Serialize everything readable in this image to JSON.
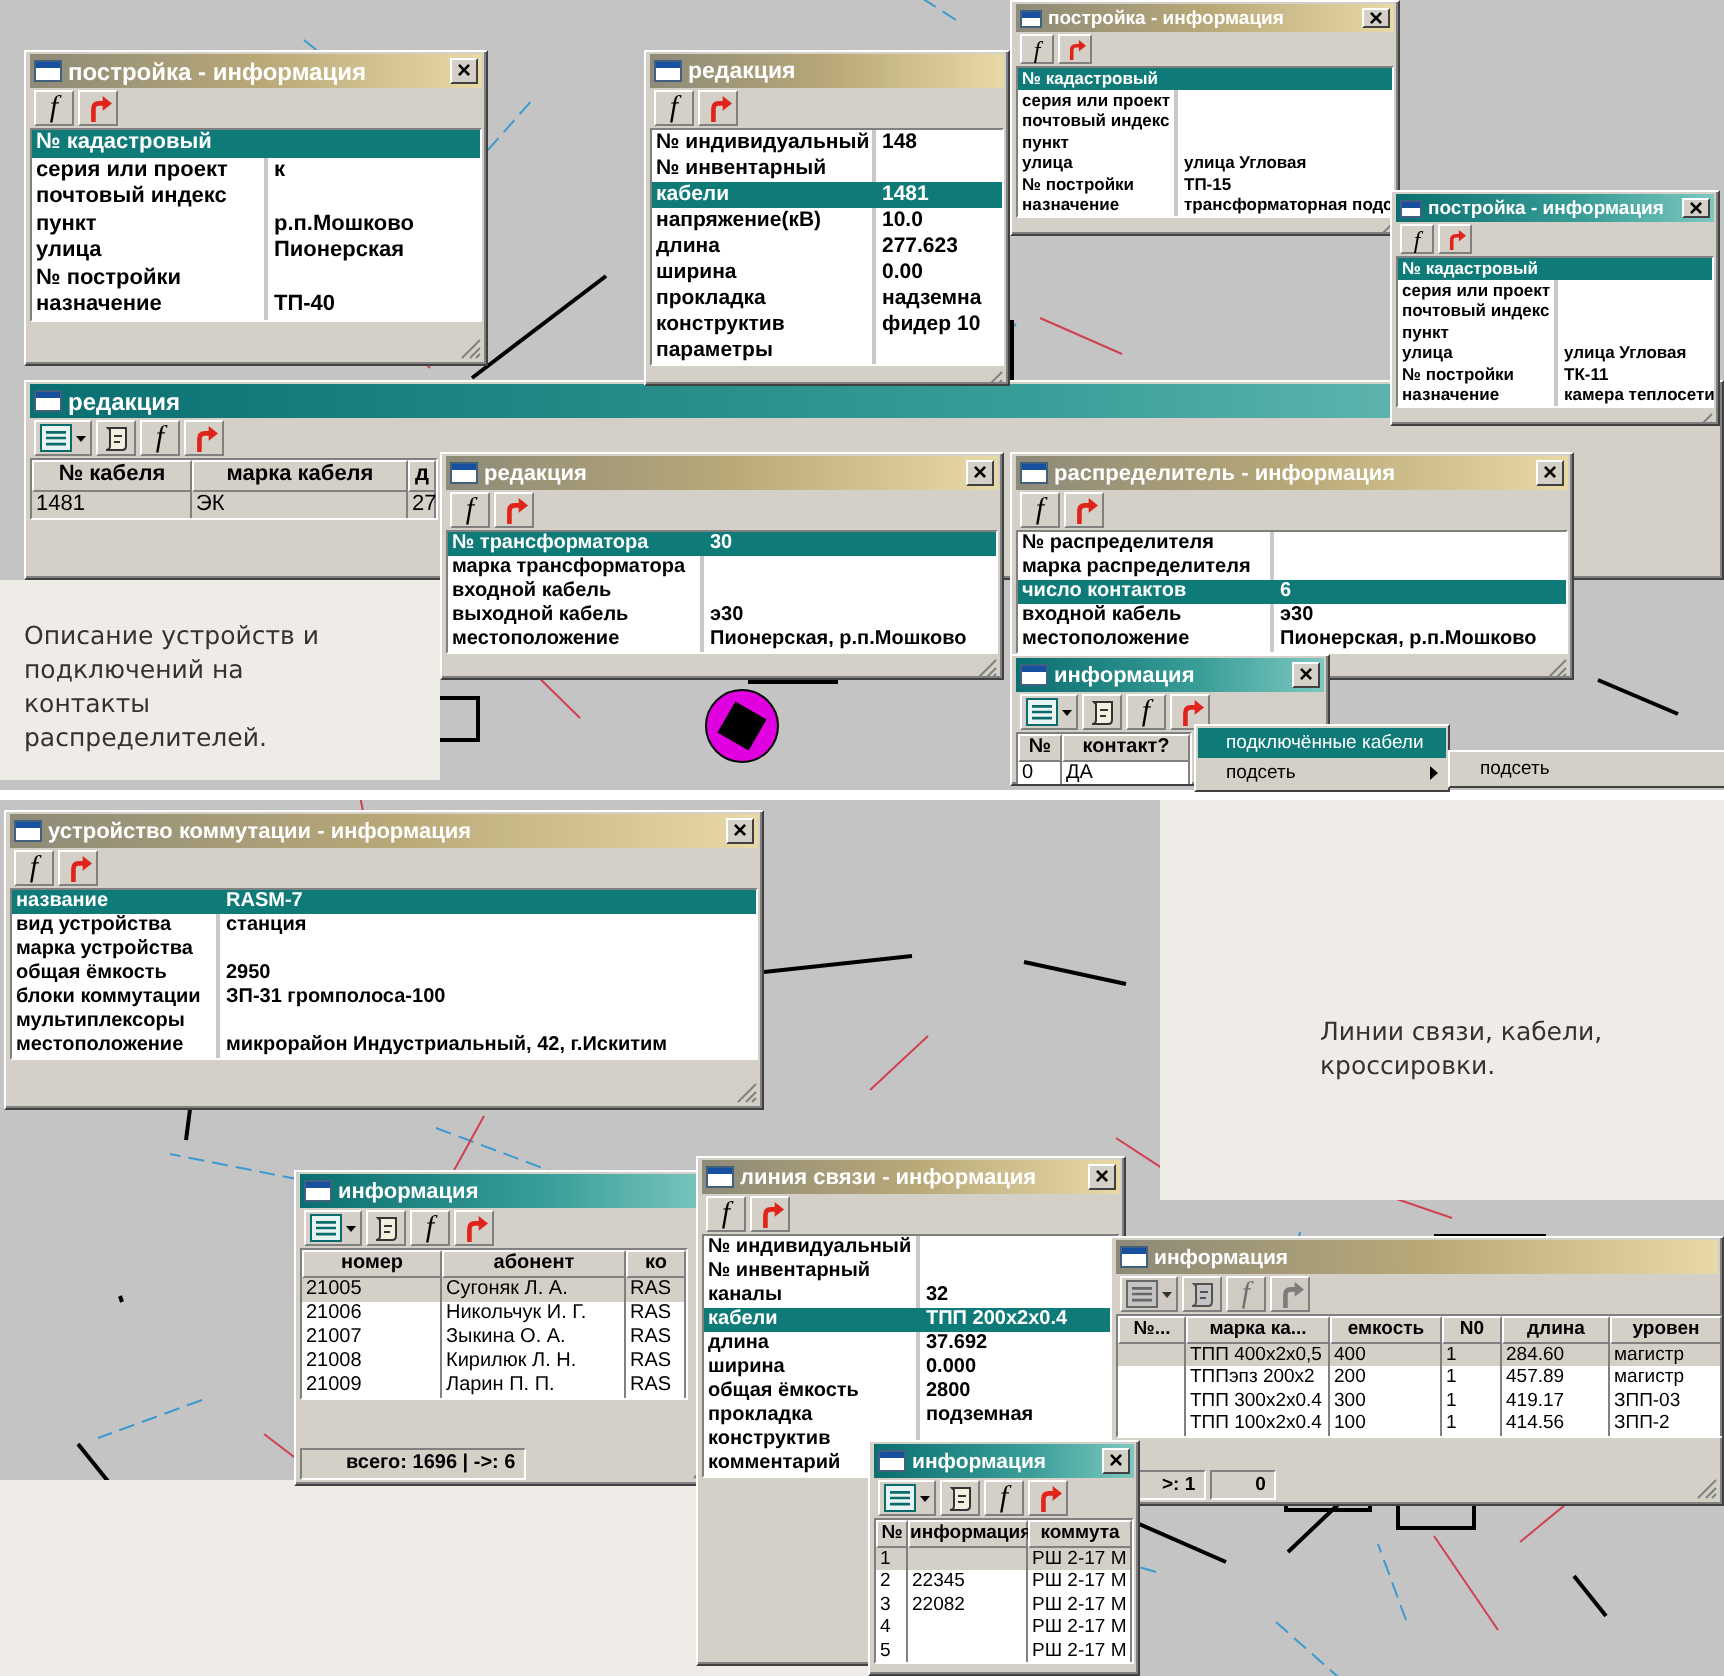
{
  "captions": [
    "Описание устройств и подключений на контакты распределителей.",
    "Линии связи, кабели, кроссировки."
  ],
  "windows": [
    {
      "kind": "props",
      "title": "постройка - информация",
      "active": false,
      "close": "×",
      "toolbar": {
        "disabled": false,
        "tools": [
          {
            "kind": "function",
            "label": "f"
          },
          {
            "kind": "back"
          }
        ]
      },
      "rows": [
        {
          "label": "№ кадастровый",
          "selected": true
        },
        {
          "label": "серия или проект",
          "value": "к",
          "selected": false
        },
        {
          "label": "почтовый индекс",
          "selected": false
        },
        {
          "label": "пункт",
          "value": "р.п.Мошково",
          "selected": false
        },
        {
          "label": "улица",
          "value": "Пионерская",
          "selected": false
        },
        {
          "label": "№ постройки",
          "selected": false
        },
        {
          "label": "назначение",
          "value": "ТП-40",
          "selected": false
        }
      ]
    },
    {
      "kind": "props",
      "title": "редакция",
      "active": false,
      "toolbar": {
        "disabled": false,
        "tools": [
          {
            "kind": "function",
            "label": "f"
          },
          {
            "kind": "back"
          }
        ]
      },
      "rows": [
        {
          "label": "№ индивидуальный",
          "value": "148",
          "selected": false
        },
        {
          "label": "№ инвентарный",
          "selected": false
        },
        {
          "label": "кабели",
          "value": "1481",
          "selected": true
        },
        {
          "label": "напряжение(кВ)",
          "value": "10.0",
          "selected": false
        },
        {
          "label": "длина",
          "value": "277.623",
          "selected": false
        },
        {
          "label": "ширина",
          "value": "0.00",
          "selected": false
        },
        {
          "label": "прокладка",
          "value": "надземна",
          "selected": false
        },
        {
          "label": "конструктив",
          "value": "фидер 10",
          "selected": false
        },
        {
          "label": "параметры",
          "selected": false
        }
      ]
    },
    {
      "kind": "props",
      "title": "постройка - информация",
      "active": false,
      "close": "×",
      "toolbar": {
        "disabled": false,
        "tools": [
          {
            "kind": "function",
            "label": "f"
          },
          {
            "kind": "back"
          }
        ]
      },
      "rows": [
        {
          "label": "№ кадастровый",
          "selected": true
        },
        {
          "label": "серия или проект",
          "selected": false
        },
        {
          "label": "почтовый индекс",
          "selected": false
        },
        {
          "label": "пункт",
          "selected": false
        },
        {
          "label": "улица",
          "value": "улица Угловая",
          "selected": false
        },
        {
          "label": "№ постройки",
          "value": "ТП-15",
          "selected": false
        },
        {
          "label": "назначение",
          "value": "трансформаторная подс",
          "selected": false
        }
      ]
    },
    {
      "kind": "props",
      "title": "постройка - информация",
      "active": true,
      "close": "×",
      "toolbar": {
        "disabled": false,
        "tools": [
          {
            "kind": "function",
            "label": "f"
          },
          {
            "kind": "back"
          }
        ]
      },
      "rows": [
        {
          "label": "№ кадастровый",
          "selected": true
        },
        {
          "label": "серия или проект",
          "selected": false
        },
        {
          "label": "почтовый индекс",
          "selected": false
        },
        {
          "label": "пункт",
          "selected": false
        },
        {
          "label": "улица",
          "value": "улица Угловая",
          "selected": false
        },
        {
          "label": "№ постройки",
          "value": "ТК-11",
          "selected": false
        },
        {
          "label": "назначение",
          "value": "камера теплосети",
          "selected": false
        }
      ]
    },
    {
      "kind": "table",
      "title": "редакция",
      "active": true,
      "toolbar": {
        "disabled": false,
        "tools": [
          {
            "kind": "list"
          },
          {
            "kind": "scroll"
          },
          {
            "kind": "function",
            "label": "f"
          },
          {
            "kind": "back"
          }
        ]
      },
      "columns": [
        "№ кабеля",
        "марка кабеля",
        "д"
      ],
      "rows": [
        {
          "cells": [
            "1481",
            "ЭК",
            "27"
          ],
          "selected": true
        }
      ]
    },
    {
      "kind": "props",
      "title": "редакция",
      "active": false,
      "close": "×",
      "toolbar": {
        "disabled": false,
        "tools": [
          {
            "kind": "function",
            "label": "f"
          },
          {
            "kind": "back"
          }
        ]
      },
      "rows": [
        {
          "label": "№ трансформатора",
          "value": "30",
          "selected": true
        },
        {
          "label": "марка трансформатора",
          "selected": false
        },
        {
          "label": "входной кабель",
          "selected": false
        },
        {
          "label": "выходной кабель",
          "value": "э30",
          "selected": false
        },
        {
          "label": "местоположение",
          "value": "Пионерская, р.п.Мошково",
          "selected": false
        }
      ]
    },
    {
      "kind": "props",
      "title": "распределитель - информация",
      "active": false,
      "close": "×",
      "toolbar": {
        "disabled": false,
        "tools": [
          {
            "kind": "function",
            "label": "f"
          },
          {
            "kind": "back"
          }
        ]
      },
      "rows": [
        {
          "label": "№ распределителя",
          "selected": false
        },
        {
          "label": "марка распределителя",
          "selected": false
        },
        {
          "label": "число контактов",
          "value": "6",
          "selected": true
        },
        {
          "label": "входной кабель",
          "value": "э30",
          "selected": false
        },
        {
          "label": "местоположение",
          "value": "Пионерская, р.п.Мошково",
          "selected": false
        }
      ]
    },
    {
      "kind": "table",
      "title": "информация",
      "active": true,
      "close": "×",
      "toolbar": {
        "disabled": false,
        "tools": [
          {
            "kind": "list"
          },
          {
            "kind": "scroll"
          },
          {
            "kind": "function",
            "label": "f"
          },
          {
            "kind": "back"
          }
        ]
      },
      "columns": [
        "№",
        "контакт?"
      ],
      "rows": [
        {
          "cells": [
            "0",
            "ДА"
          ],
          "selected": false
        }
      ]
    },
    {
      "kind": "props",
      "title": "устройство коммутации - информация",
      "active": false,
      "close": "×",
      "toolbar": {
        "disabled": false,
        "tools": [
          {
            "kind": "function",
            "label": "f"
          },
          {
            "kind": "back"
          }
        ]
      },
      "rows": [
        {
          "label": "название",
          "value": "RASM-7",
          "selected": true
        },
        {
          "label": "вид устройства",
          "value": "станция",
          "selected": false
        },
        {
          "label": "марка устройства",
          "selected": false
        },
        {
          "label": "общая ёмкость",
          "value": "2950",
          "selected": false
        },
        {
          "label": "блоки коммутации",
          "value": "ЗП-31 громполоса-100",
          "selected": false
        },
        {
          "label": "мультиплексоры",
          "selected": false
        },
        {
          "label": "местоположение",
          "value": "микрорайон Индустриальный, 42, г.Искитим",
          "selected": false
        }
      ]
    },
    {
      "kind": "table",
      "title": "информация",
      "active": true,
      "toolbar": {
        "disabled": false,
        "tools": [
          {
            "kind": "list"
          },
          {
            "kind": "scroll"
          },
          {
            "kind": "function",
            "label": "f"
          },
          {
            "kind": "back"
          }
        ]
      },
      "columns": [
        "номер",
        "абонент",
        "ко"
      ],
      "rows": [
        {
          "cells": [
            "21005",
            "Сугоняк Л. А.",
            "RAS"
          ],
          "selected": true
        },
        {
          "cells": [
            "21006",
            "Никольчук И. Г.",
            "RAS"
          ],
          "selected": false
        },
        {
          "cells": [
            "21007",
            "Зыкина О. А.",
            "RAS"
          ],
          "selected": false
        },
        {
          "cells": [
            "21008",
            "Кирилюк Л. Н.",
            "RAS"
          ],
          "selected": false
        },
        {
          "cells": [
            "21009",
            "Ларин П. П.",
            "RAS"
          ],
          "selected": false
        }
      ],
      "status": [
        "всего: 1696 | ->: 6"
      ]
    },
    {
      "kind": "props",
      "title": "линия связи - информация",
      "active": false,
      "close": "×",
      "toolbar": {
        "disabled": false,
        "tools": [
          {
            "kind": "function",
            "label": "f"
          },
          {
            "kind": "back"
          }
        ]
      },
      "rows": [
        {
          "label": "№ индивидуальный",
          "selected": false
        },
        {
          "label": "№ инвентарный",
          "selected": false
        },
        {
          "label": "каналы",
          "value": "32",
          "selected": false
        },
        {
          "label": "кабели",
          "value": "ТПП 200x2x0.4",
          "selected": true
        },
        {
          "label": "длина",
          "value": "37.692",
          "selected": false
        },
        {
          "label": "ширина",
          "value": "0.000",
          "selected": false
        },
        {
          "label": "общая ёмкость",
          "value": "2800",
          "selected": false
        },
        {
          "label": "прокладка",
          "value": "подземная",
          "selected": false
        },
        {
          "label": "конструктив",
          "selected": false
        },
        {
          "label": "комментарий",
          "selected": false
        }
      ]
    },
    {
      "kind": "table",
      "title": "информация",
      "active": false,
      "toolbar": {
        "disabled": true,
        "tools": [
          {
            "kind": "list"
          },
          {
            "kind": "scroll"
          },
          {
            "kind": "function",
            "label": "f"
          },
          {
            "kind": "back"
          }
        ]
      },
      "columns": [
        "№...",
        "марка ка...",
        "емкость",
        "N0",
        "длина",
        "уровен"
      ],
      "rows": [
        {
          "cells": [
            null,
            "ТПП 400x2x0,5",
            "400",
            "1",
            "284.60",
            "магистр"
          ],
          "selected": true
        },
        {
          "cells": [
            null,
            "ТППэпз 200x2",
            "200",
            "1",
            "457.89",
            "магистр"
          ],
          "selected": false
        },
        {
          "cells": [
            null,
            "ТПП 300x2x0.4",
            "300",
            "1",
            "419.17",
            "ЗПП-03"
          ],
          "selected": false
        },
        {
          "cells": [
            null,
            "ТПП 100x2x0.4",
            "100",
            "1",
            "414.56",
            "ЗПП-2"
          ],
          "selected": false
        }
      ],
      "status": [
        ">: 1",
        "0"
      ]
    },
    {
      "kind": "table",
      "title": "информация",
      "active": true,
      "close": "×",
      "toolbar": {
        "disabled": false,
        "tools": [
          {
            "kind": "list"
          },
          {
            "kind": "scroll"
          },
          {
            "kind": "function",
            "label": "f"
          },
          {
            "kind": "back"
          }
        ]
      },
      "columns": [
        "№",
        "информация",
        "коммута"
      ],
      "rows": [
        {
          "cells": [
            "1",
            null,
            "РШ 2-17 М"
          ],
          "selected": true
        },
        {
          "cells": [
            "2",
            "22345",
            "РШ 2-17 М"
          ],
          "selected": false
        },
        {
          "cells": [
            "3",
            "22082",
            "РШ 2-17 М"
          ],
          "selected": false
        },
        {
          "cells": [
            "4",
            null,
            "РШ 2-17 М"
          ],
          "selected": false
        },
        {
          "cells": [
            "5",
            null,
            "РШ 2-17 М"
          ],
          "selected": false
        }
      ]
    }
  ],
  "context_menu": {
    "items": [
      {
        "label": "подключённые кабели",
        "selected": true,
        "has_submenu": false
      },
      {
        "label": "подсеть",
        "selected": false,
        "has_submenu": true
      }
    ],
    "submenu": {
      "items": [
        {
          "label": "подсеть",
          "selected": false
        }
      ]
    }
  }
}
